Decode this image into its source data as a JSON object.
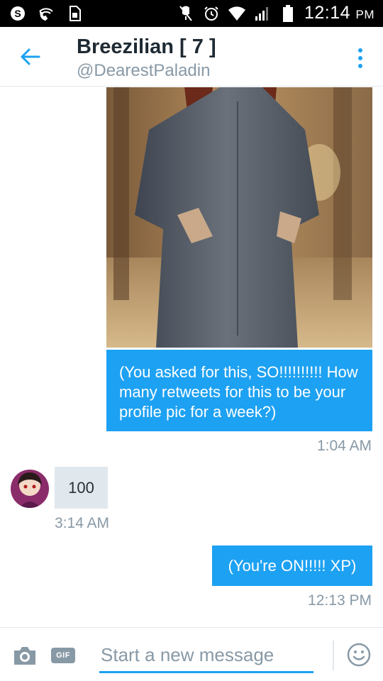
{
  "status_bar": {
    "time": "12:14",
    "ampm": "PM",
    "icons": [
      "skype-icon",
      "wifi-call-icon",
      "sim-icon",
      "mute-icon",
      "alarm-icon",
      "wifi-icon",
      "signal-icon",
      "battery-icon"
    ]
  },
  "header": {
    "title": "Breezilian [ 7 ]",
    "handle": "@DearestPaladin",
    "back_icon": "arrow-left-icon",
    "menu_icon": "more-vert-icon"
  },
  "messages": [
    {
      "direction": "outgoing",
      "type": "image+text",
      "text": "(You asked for this, SO!!!!!!!!!! How many retweets for this to be your profile pic for a week?)",
      "time": "1:04 AM"
    },
    {
      "direction": "incoming",
      "type": "text",
      "text": "100",
      "time": "3:14 AM"
    },
    {
      "direction": "outgoing",
      "type": "text",
      "text": "(You're ON!!!!! XP)",
      "time": "12:13 PM"
    }
  ],
  "composer": {
    "placeholder": "Start a new message",
    "gif_label": "GIF",
    "camera_icon": "camera-icon",
    "emoji_icon": "smiley-icon"
  },
  "colors": {
    "accent": "#1da1f2",
    "incoming_bubble": "#e1e8ed",
    "muted_text": "#8899a6"
  }
}
